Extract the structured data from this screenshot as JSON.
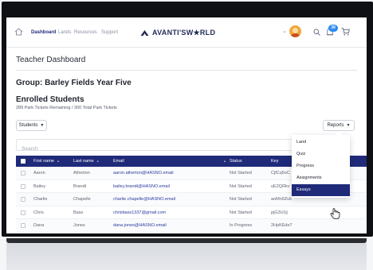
{
  "nav": {
    "links": [
      "Dashboard",
      "Lands",
      "Resources",
      "Support"
    ],
    "active": "Dashboard",
    "brand": "AVANTI'SW★RLD",
    "cart_badge": "39",
    "icons": [
      "home-icon",
      "brand-mark-icon",
      "chevron-down-icon",
      "avatar",
      "search-icon",
      "notification-icon",
      "cart-icon"
    ]
  },
  "page": {
    "title": "Teacher Dashboard",
    "group": "Group: Barley Fields Year Five",
    "enrolled_title": "Enrolled Students",
    "tickets": "289 Park Tickets Remaining / 300 Total Park Tickets"
  },
  "toolbar": {
    "students_label": "Students",
    "reports_label": "Reports",
    "search_placeholder": "Search"
  },
  "table": {
    "columns": [
      "First name",
      "Last name",
      "Email",
      "Status",
      "Key"
    ],
    "rows": [
      {
        "first": "Aaron",
        "last": "Atherton",
        "email": "aaron.atherton@HASNO.email",
        "status": "Not Started",
        "key": "CjfCq5oC"
      },
      {
        "first": "Bailey",
        "last": "Brandt",
        "email": "bailey.brandt@HASNO.email",
        "status": "Not Started",
        "key": "uE2QRkv"
      },
      {
        "first": "Charlie",
        "last": "Chapelle",
        "email": "charlie.chapelle@HASNO.email",
        "status": "Not Started",
        "key": "aoMn9Zuk"
      },
      {
        "first": "Chris",
        "last": "Bass",
        "email": "chrisbass1337@gmail.com",
        "status": "Not Started",
        "key": "pjG3UUj"
      },
      {
        "first": "Dana",
        "last": "Jones",
        "email": "dana.jones@HASNO.email",
        "status": "In Progress",
        "key": "2HpKEde7"
      }
    ]
  },
  "reports_menu": {
    "items": [
      "Land",
      "Quiz",
      "Progress",
      "Assignments",
      "Essays"
    ],
    "selected": "Essays"
  },
  "colors": {
    "primary": "#1f2a79",
    "link": "#2b3aa0",
    "badge": "#2d8cf0",
    "avatar": "#f0a63a"
  }
}
